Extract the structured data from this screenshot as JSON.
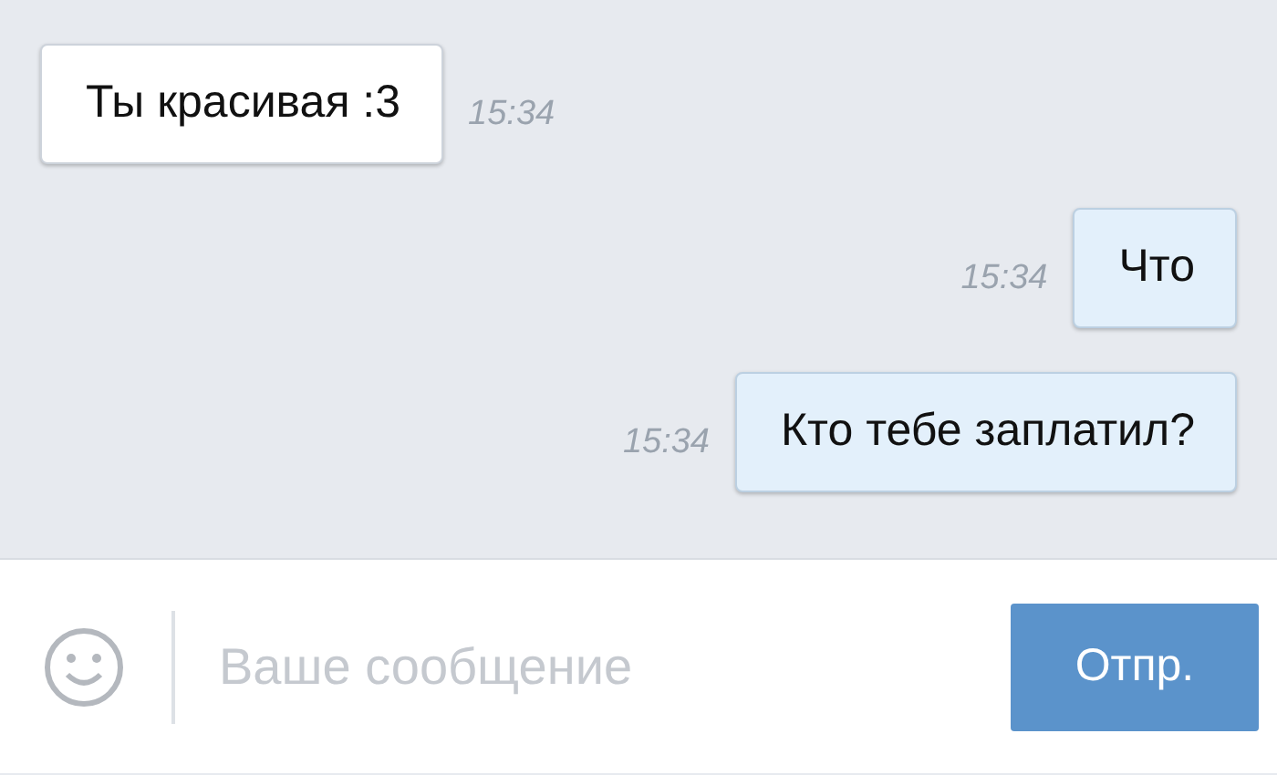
{
  "messages": [
    {
      "text": "Ты красивая :3",
      "time": "15:34",
      "kind": "incoming"
    },
    {
      "text": "Что",
      "time": "15:34",
      "kind": "outgoing"
    },
    {
      "text": "Кто тебе заплатил?",
      "time": "15:34",
      "kind": "outgoing"
    }
  ],
  "composer": {
    "placeholder": "Ваше сообщение",
    "send_button": "Отпр."
  }
}
